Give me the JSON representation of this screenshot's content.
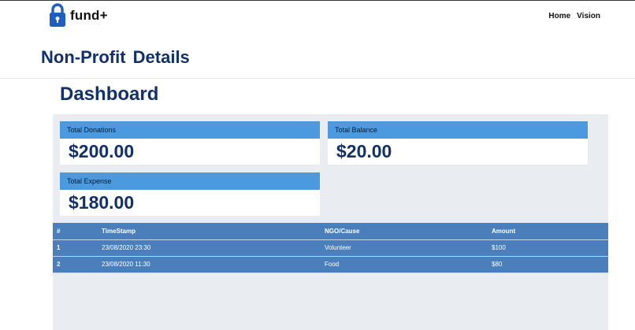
{
  "header": {
    "brand": "fund+",
    "nav": [
      {
        "label": "Home"
      },
      {
        "label": "Vision"
      }
    ]
  },
  "page_title": "Non-Profit  Details",
  "dashboard": {
    "title": "Dashboard",
    "cards": {
      "donations": {
        "label": "Total Donations",
        "value": "$200.00"
      },
      "balance": {
        "label": "Total Balance",
        "value": "$20.00"
      },
      "expense": {
        "label": "Total Expense",
        "value": "$180.00"
      }
    }
  },
  "table": {
    "columns": [
      "#",
      "TimeStamp",
      "NGO/Cause",
      "Amount"
    ],
    "rows": [
      {
        "num": "1",
        "timestamp": "23/08/2020 23:30",
        "cause": "Volunteer",
        "amount": "$100"
      },
      {
        "num": "2",
        "timestamp": "23/08/2020 11:30",
        "cause": "Food",
        "amount": "$80"
      }
    ]
  },
  "colors": {
    "title": "#12306a",
    "card_header": "#4b9ae0",
    "table": "#4a7fbb",
    "panel": "#e9ecf1"
  },
  "icons": {
    "logo": "padlock-icon"
  }
}
